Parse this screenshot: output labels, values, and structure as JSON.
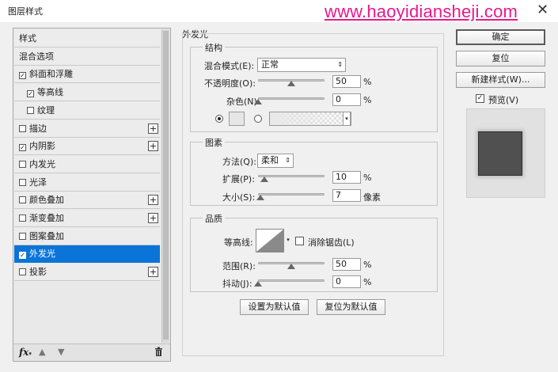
{
  "window": {
    "title": "图层样式",
    "watermark": "www.haoyidiansheji.com"
  },
  "styles_list": {
    "items": [
      {
        "label": "样式",
        "checkbox": false,
        "checked": false,
        "sub": false,
        "plus": false,
        "selected": false
      },
      {
        "label": "混合选项",
        "checkbox": false,
        "checked": false,
        "sub": false,
        "plus": false,
        "selected": false
      },
      {
        "label": "斜面和浮雕",
        "checkbox": true,
        "checked": true,
        "sub": false,
        "plus": false,
        "selected": false
      },
      {
        "label": "等高线",
        "checkbox": true,
        "checked": true,
        "sub": true,
        "plus": false,
        "selected": false
      },
      {
        "label": "纹理",
        "checkbox": true,
        "checked": false,
        "sub": true,
        "plus": false,
        "selected": false
      },
      {
        "label": "描边",
        "checkbox": true,
        "checked": false,
        "sub": false,
        "plus": true,
        "selected": false
      },
      {
        "label": "内阴影",
        "checkbox": true,
        "checked": true,
        "sub": false,
        "plus": true,
        "selected": false
      },
      {
        "label": "内发光",
        "checkbox": true,
        "checked": false,
        "sub": false,
        "plus": false,
        "selected": false
      },
      {
        "label": "光泽",
        "checkbox": true,
        "checked": false,
        "sub": false,
        "plus": false,
        "selected": false
      },
      {
        "label": "颜色叠加",
        "checkbox": true,
        "checked": false,
        "sub": false,
        "plus": true,
        "selected": false
      },
      {
        "label": "渐变叠加",
        "checkbox": true,
        "checked": false,
        "sub": false,
        "plus": true,
        "selected": false
      },
      {
        "label": "图案叠加",
        "checkbox": true,
        "checked": false,
        "sub": false,
        "plus": false,
        "selected": false
      },
      {
        "label": "外发光",
        "checkbox": true,
        "checked": true,
        "sub": false,
        "plus": false,
        "selected": true
      },
      {
        "label": "投影",
        "checkbox": true,
        "checked": false,
        "sub": false,
        "plus": true,
        "selected": false
      }
    ],
    "footer": {
      "fx_label": "fx",
      "up_icon": "arrow-up-icon",
      "down_icon": "arrow-down-icon",
      "delete_icon": "trash-icon"
    }
  },
  "outer_glow": {
    "title": "外发光",
    "structure": {
      "title": "结构",
      "blend_mode_label": "混合模式(E):",
      "blend_mode_value": "正常",
      "opacity_label": "不透明度(O):",
      "opacity_value": "50",
      "opacity_unit": "%",
      "noise_label": "杂色(N):",
      "noise_value": "0",
      "noise_unit": "%"
    },
    "elements": {
      "title": "图素",
      "technique_label": "方法(Q):",
      "technique_value": "柔和",
      "spread_label": "扩展(P):",
      "spread_value": "10",
      "spread_unit": "%",
      "size_label": "大小(S):",
      "size_value": "7",
      "size_unit": "像素"
    },
    "quality": {
      "title": "品质",
      "contour_label": "等高线:",
      "antialias_label": "消除锯齿(L)",
      "range_label": "范围(R):",
      "range_value": "50",
      "range_unit": "%",
      "jitter_label": "抖动(J):",
      "jitter_value": "0",
      "jitter_unit": "%"
    },
    "make_default_label": "设置为默认值",
    "reset_default_label": "复位为默认值"
  },
  "actions": {
    "ok_label": "确定",
    "reset_label": "复位",
    "new_style_label": "新建样式(W)...",
    "preview_label": "预览(V)",
    "preview_checked": true
  },
  "colors": {
    "selection": "#0a74d9",
    "watermark": "#e8198b",
    "preview_swatch": "#505050"
  }
}
